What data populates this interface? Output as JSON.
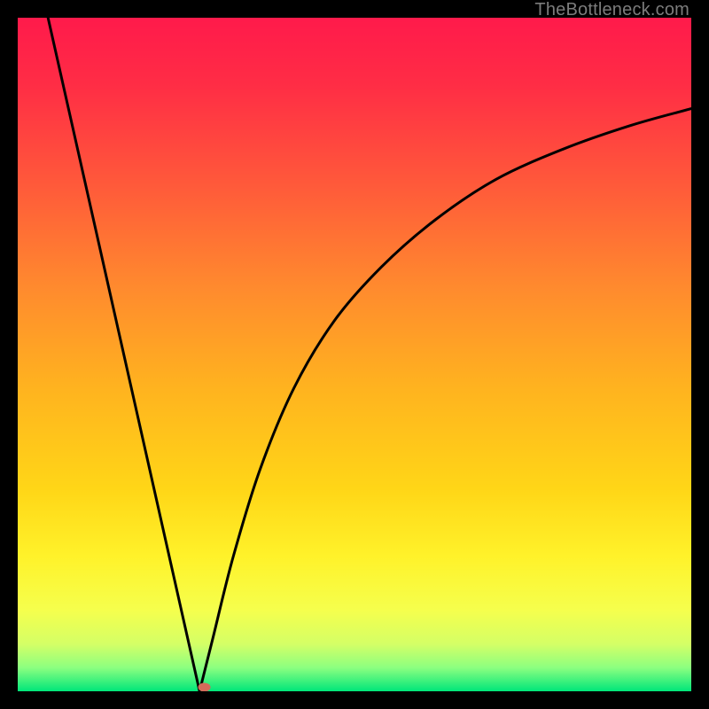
{
  "watermark": "TheBottleneck.com",
  "chart_data": {
    "type": "line",
    "title": "",
    "xlabel": "",
    "ylabel": "",
    "xlim": [
      0,
      100
    ],
    "ylim": [
      0,
      100
    ],
    "grid": false,
    "legend": false,
    "background_gradient": {
      "stops": [
        {
          "pos": 0.0,
          "color": "#ff1a4b"
        },
        {
          "pos": 0.1,
          "color": "#ff2d45"
        },
        {
          "pos": 0.25,
          "color": "#ff5a3a"
        },
        {
          "pos": 0.4,
          "color": "#ff8a2e"
        },
        {
          "pos": 0.55,
          "color": "#ffb31f"
        },
        {
          "pos": 0.7,
          "color": "#ffd617"
        },
        {
          "pos": 0.8,
          "color": "#fff22a"
        },
        {
          "pos": 0.88,
          "color": "#f5ff4d"
        },
        {
          "pos": 0.93,
          "color": "#d4ff66"
        },
        {
          "pos": 0.965,
          "color": "#8cff80"
        },
        {
          "pos": 1.0,
          "color": "#00e67a"
        }
      ]
    },
    "series": [
      {
        "name": "left-branch",
        "x": [
          4.5,
          27.0
        ],
        "y": [
          100,
          0
        ]
      },
      {
        "name": "right-branch",
        "x": [
          27.0,
          29,
          32,
          36,
          41,
          47,
          54,
          62,
          71,
          81,
          91,
          100
        ],
        "y": [
          0,
          8,
          20,
          33,
          45,
          55,
          63,
          70,
          76,
          80.5,
          84,
          86.5
        ]
      }
    ],
    "marker": {
      "name": "min-marker",
      "x": 27.7,
      "y": 0.6,
      "color": "#d46a5a"
    }
  }
}
